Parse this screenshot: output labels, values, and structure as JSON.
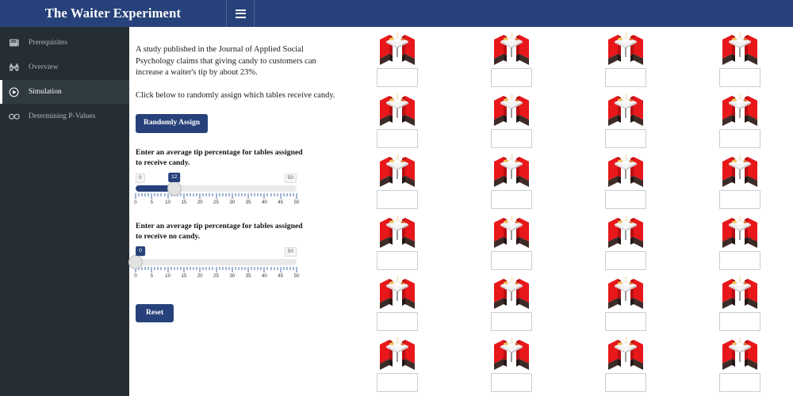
{
  "header": {
    "title": "The Waiter Experiment",
    "menu_icon": "hamburger-icon",
    "background_color": "#27417a"
  },
  "sidebar": {
    "background_color": "#252e34",
    "active_index": 2,
    "items": [
      {
        "label": "Prerequisites",
        "icon": "book-icon",
        "active": false
      },
      {
        "label": "Overview",
        "icon": "binoculars-icon",
        "active": false
      },
      {
        "label": "Simulation",
        "icon": "play-circle-icon",
        "active": true
      },
      {
        "label": "Determining P-Values",
        "icon": "glasses-icon",
        "active": false
      }
    ]
  },
  "main": {
    "paragraphs": [
      "A study published in the Journal of Applied Social Psychology claims that giving candy to customers can increase a waiter's tip by about 23%.",
      "Click below to randomly assign which tables receive candy."
    ],
    "randomly_assign_label": "Randomly Assign",
    "reset_label": "Reset",
    "accent_color": "#27417a"
  },
  "sliders": [
    {
      "name": "candy-tip-slider",
      "label": "Enter an average tip percentage for tables assigned to receive candy.",
      "value": 12,
      "min": 0,
      "max": 50,
      "min_label": "0",
      "max_label": "50",
      "bubble_text": "12",
      "tick_labels": [
        "0",
        "5",
        "10",
        "15",
        "20",
        "25",
        "30",
        "35",
        "40",
        "45",
        "50"
      ]
    },
    {
      "name": "no-candy-tip-slider",
      "label": "Enter an average tip percentage for tables assigned to receive no candy.",
      "value": 0,
      "min": 0,
      "max": 50,
      "min_label": "0",
      "max_label": "50",
      "bubble_text": "0",
      "tick_labels": [
        "0",
        "5",
        "10",
        "15",
        "20",
        "25",
        "30",
        "35",
        "40",
        "45",
        "50"
      ]
    }
  ],
  "tables": {
    "rows": 6,
    "columns": 4,
    "count": 24,
    "booth_icon": "restaurant-booth-icon",
    "input_value": "",
    "input_placeholder": ""
  }
}
